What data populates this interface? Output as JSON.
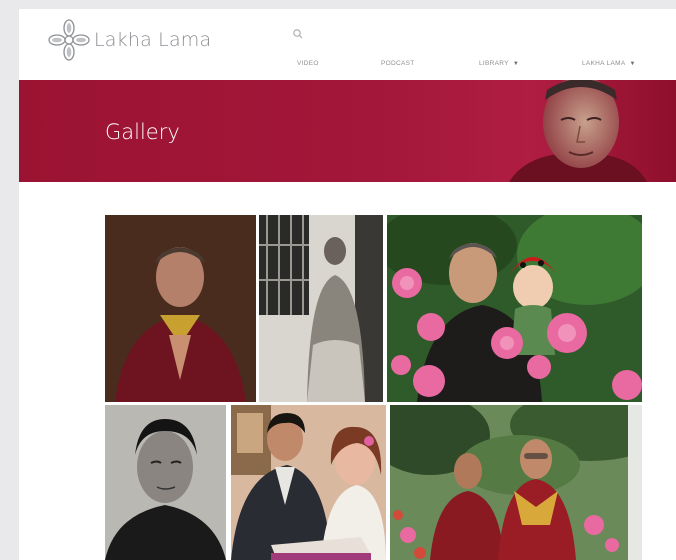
{
  "site": {
    "name": "Lakha Lama",
    "logo_icon": "endless-knot-logo-icon",
    "search_icon": "search-icon"
  },
  "nav": {
    "items": [
      {
        "label": "VIDEO",
        "has_dropdown": false
      },
      {
        "label": "PODCAST",
        "has_dropdown": false
      },
      {
        "label": "LIBRARY",
        "has_dropdown": true
      },
      {
        "label": "LAKHA LAMA",
        "has_dropdown": true
      }
    ]
  },
  "banner": {
    "title": "Gallery",
    "background_color": "#a3173a"
  },
  "gallery": {
    "photos": [
      {
        "subject": "lama-in-red-robes-praying-portrait"
      },
      {
        "subject": "woman-seated-black-and-white-photo"
      },
      {
        "subject": "lama-with-child-and-pink-flowers"
      },
      {
        "subject": "young-man-black-and-white-portrait"
      },
      {
        "subject": "man-and-woman-reading-book"
      },
      {
        "subject": "two-lamas-in-garden"
      }
    ]
  },
  "colors": {
    "accent": "#a3173a",
    "text_muted": "#8c8f94",
    "page_background": "#e9e9ec"
  }
}
